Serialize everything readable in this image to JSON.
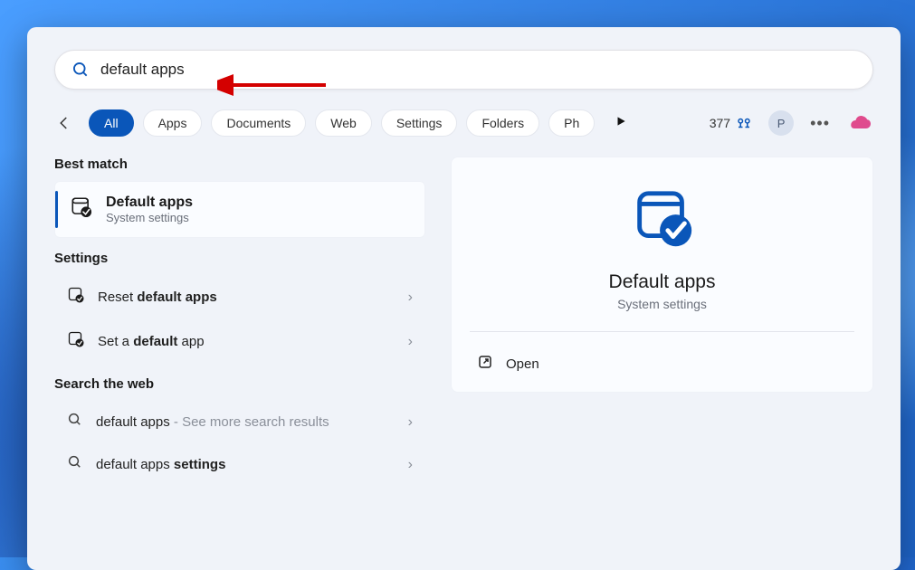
{
  "search": {
    "query": "default apps"
  },
  "filters": {
    "items": [
      "All",
      "Apps",
      "Documents",
      "Web",
      "Settings",
      "Folders",
      "Ph"
    ],
    "active_index": 0
  },
  "rewards": {
    "points": "377",
    "avatar_initial": "P"
  },
  "results": {
    "best_match_header": "Best match",
    "best_match": {
      "title": "Default apps",
      "subtitle": "System settings"
    },
    "settings_header": "Settings",
    "settings_items": [
      {
        "prefix": "Reset ",
        "bold": "default apps",
        "suffix": ""
      },
      {
        "prefix": "Set a ",
        "bold": "default",
        "suffix": " app"
      }
    ],
    "web_header": "Search the web",
    "web_items": [
      {
        "text": "default apps",
        "suffix": " - See more search results"
      },
      {
        "text": "default apps ",
        "bold": "settings",
        "suffix": ""
      }
    ]
  },
  "preview": {
    "title": "Default apps",
    "subtitle": "System settings",
    "open_label": "Open"
  },
  "colors": {
    "accent": "#0a56b9"
  }
}
